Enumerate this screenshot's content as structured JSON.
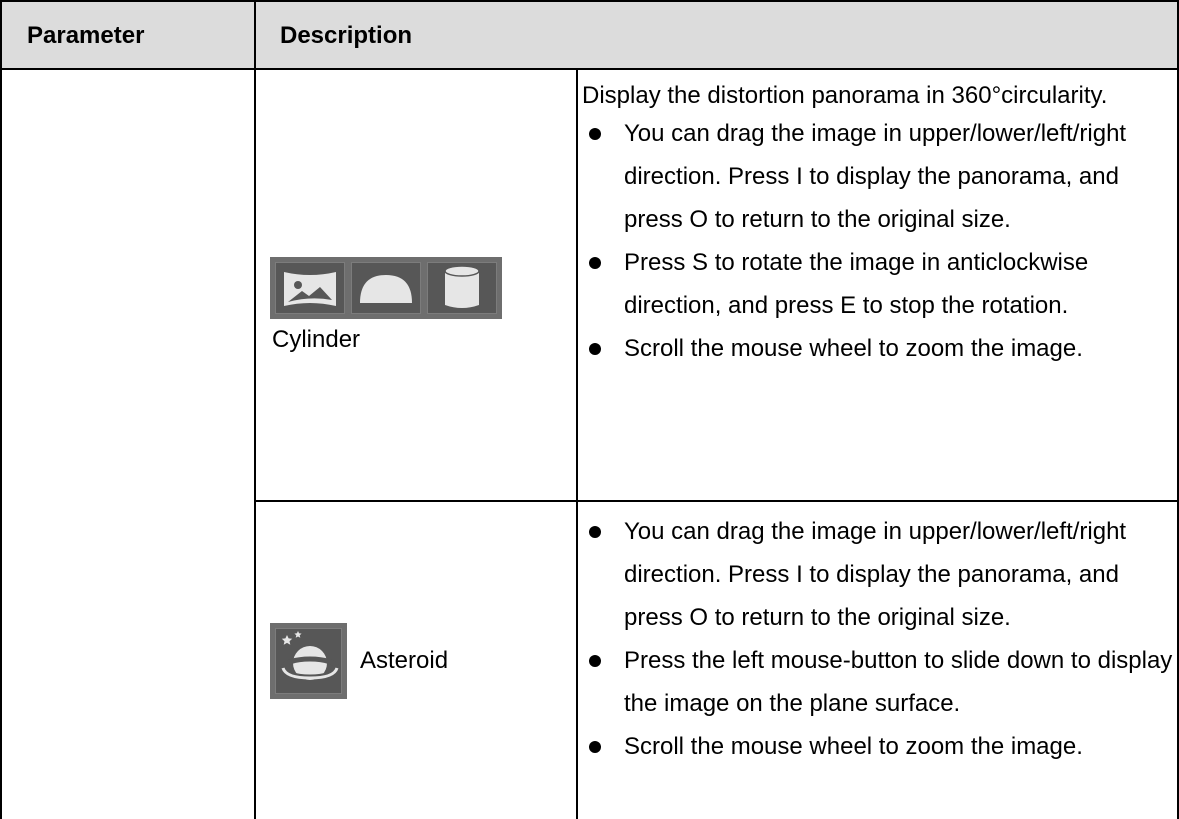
{
  "table": {
    "header": {
      "parameter": "Parameter",
      "description": "Description"
    },
    "rows": [
      {
        "mode_label": "Cylinder",
        "icons": [
          "flat-panorama-icon",
          "dome-icon",
          "cylinder-icon"
        ],
        "intro": "Display the distortion panorama in 360°circularity.",
        "bullets": [
          "You can drag the image in upper/lower/left/right direction. Press I to display the panorama, and press O to return to the original size.",
          "Press S to rotate the image in anticlockwise direction, and press E to stop the rotation.",
          "Scroll the mouse wheel to zoom the image."
        ]
      },
      {
        "mode_label": "Asteroid",
        "icons": [
          "asteroid-planet-icon"
        ],
        "bullets": [
          "You can drag the image in upper/lower/left/right direction. Press I to display the panorama, and press O to return to the original size.",
          "Press the left mouse-button to slide down to display the image on the plane surface.",
          "Scroll the mouse wheel to zoom the image."
        ]
      }
    ]
  },
  "colors": {
    "header_bg": "#dcdcdc",
    "icon_bg": "#6e6e6e",
    "icon_cell_bg": "#575757",
    "icon_fg": "#e6e6e6"
  }
}
